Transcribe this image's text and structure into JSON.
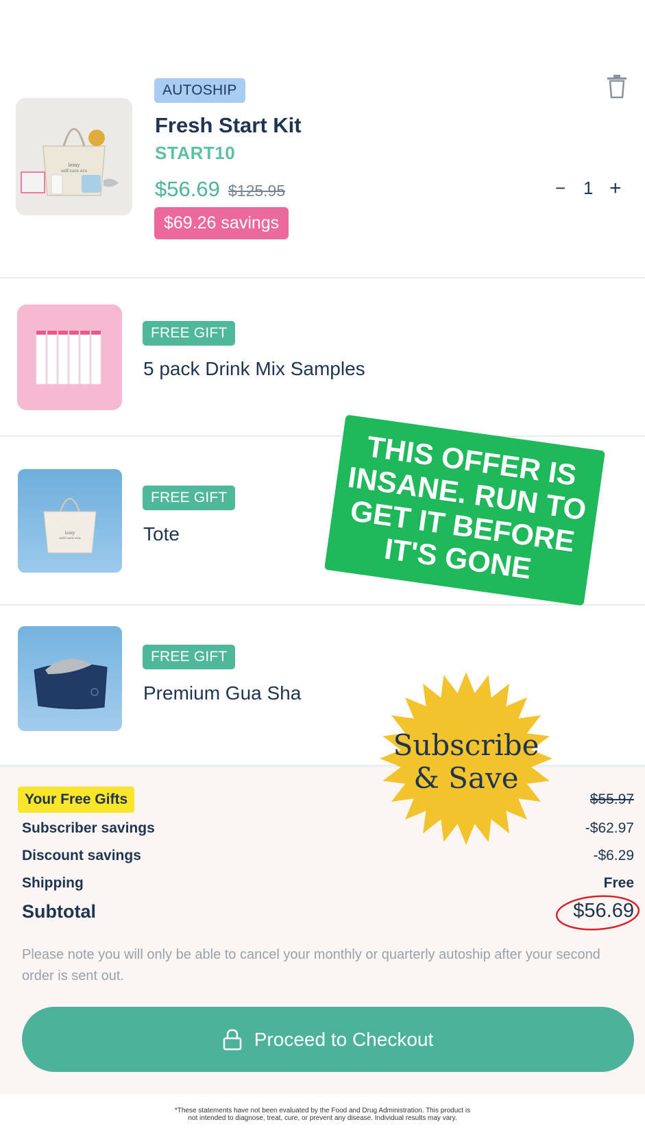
{
  "cart_items": [
    {
      "badge": "AUTOSHIP",
      "name": "Fresh Start Kit",
      "code": "START10",
      "price": "$56.69",
      "original_price": "$125.95",
      "savings": "$69.26 savings",
      "quantity": "1",
      "decrement": "−",
      "increment": "+"
    },
    {
      "badge": "FREE GIFT",
      "name": "5 pack Drink Mix Samples"
    },
    {
      "badge": "FREE GIFT",
      "name": "Tote"
    },
    {
      "badge": "FREE GIFT",
      "name": "Premium Gua Sha"
    }
  ],
  "promo": {
    "sticker_text": "THIS OFFER IS INSANE. RUN TO GET IT BEFORE IT'S GONE",
    "badge_line1": "Subscribe",
    "badge_line2": "& Save"
  },
  "summary": {
    "free_gifts_label": "Your Free Gifts",
    "free_gifts_value": "$55.97",
    "subscriber_label": "Subscriber savings",
    "subscriber_value": "-$62.97",
    "discount_label": "Discount savings",
    "discount_value": "-$6.29",
    "shipping_label": "Shipping",
    "shipping_value": "Free",
    "subtotal_label": "Subtotal",
    "subtotal_value": "$56.69",
    "note": "Please note you will only be able to cancel your monthly or quarterly autoship after your second order is sent out."
  },
  "checkout": {
    "label": "Proceed to Checkout"
  },
  "disclaimer": {
    "line1": "*These statements have not been evaluated by the Food and Drug Administration. This product is",
    "line2": "not intended to diagnose, treat, cure, or prevent any disease. Individual results may vary."
  },
  "colors": {
    "accent_teal": "#4cb39a",
    "savings_pink": "#eb6a9b",
    "autoship_blue": "#a9cdf2",
    "highlight_yellow": "#f9e52a",
    "sticker_green": "#1fb85b",
    "badge_gold": "#f2c32c"
  },
  "icons": [
    "trash-icon",
    "lock-icon",
    "minus-icon",
    "plus-icon"
  ]
}
